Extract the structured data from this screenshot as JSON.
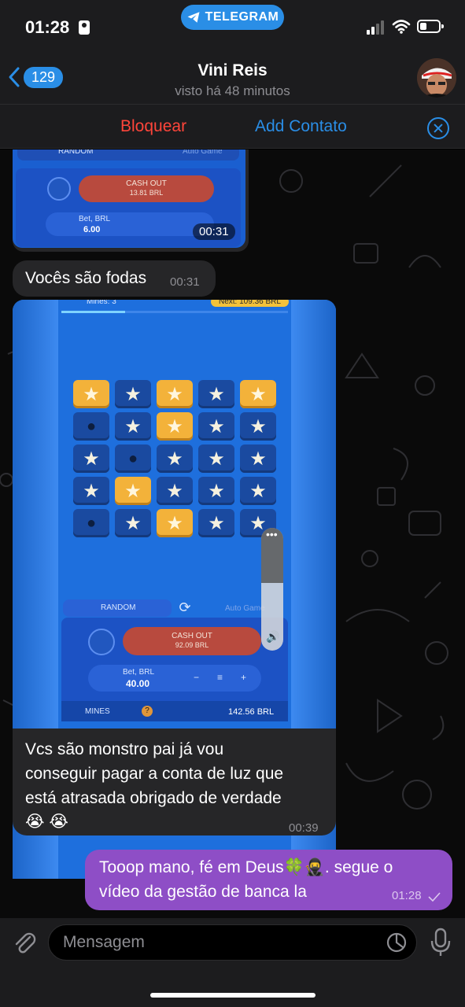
{
  "status_bar": {
    "time": "01:28",
    "app_pill": "TELEGRAM"
  },
  "header": {
    "back_count": "129",
    "contact_name": "Vini Reis",
    "last_seen": "visto há 48 minutos"
  },
  "action_bar": {
    "block_label": "Bloquear",
    "add_contact_label": "Add Contato"
  },
  "messages": [
    {
      "type": "video",
      "direction": "incoming",
      "time": "00:31",
      "screen": {
        "random_label": "RANDOM",
        "auto_label": "Auto Game",
        "cash_out_label": "CASH OUT",
        "cash_out_value": "13.81 BRL",
        "bet_label": "Bet, BRL",
        "bet_value": "6.00"
      }
    },
    {
      "type": "text",
      "direction": "incoming",
      "text": "Vocês são fodas",
      "time": "00:31"
    },
    {
      "type": "video",
      "direction": "incoming",
      "screen": {
        "mines_label": "Mines: 3",
        "next_label": "Next: 109.36 BRL",
        "grid": [
          [
            "gold",
            "star",
            "gold",
            "star",
            "gold"
          ],
          [
            "bomb",
            "star",
            "gold",
            "star",
            "star"
          ],
          [
            "star",
            "bomb",
            "star",
            "star",
            "star"
          ],
          [
            "star",
            "gold",
            "star",
            "star",
            "star"
          ],
          [
            "bomb",
            "star",
            "gold",
            "star",
            "star"
          ]
        ],
        "random_label": "RANDOM",
        "auto_label": "Auto Game",
        "cash_out_label": "CASH OUT",
        "cash_out_value": "92.09 BRL",
        "bet_label": "Bet, BRL",
        "bet_value": "40.00",
        "footer_game": "MINES",
        "balance": "142.56 BRL"
      }
    },
    {
      "type": "text",
      "direction": "incoming",
      "lines": [
        "Vcs são monstro pai já vou",
        "conseguir pagar a conta de luz que",
        "está atrasada obrigado de verdade",
        "😭 😭"
      ],
      "time": "00:39"
    },
    {
      "type": "text",
      "direction": "outgoing",
      "lines": [
        "Tooop mano, fé em Deus🍀🥷. segue o",
        "vídeo da gestão de banca la"
      ],
      "time": "01:28"
    }
  ],
  "input": {
    "placeholder": "Mensagem"
  },
  "colors": {
    "accent": "#2a8ee6",
    "danger": "#ff453a",
    "outgoing_bubble": "#8e4ec6",
    "incoming_bubble": "#262628"
  }
}
